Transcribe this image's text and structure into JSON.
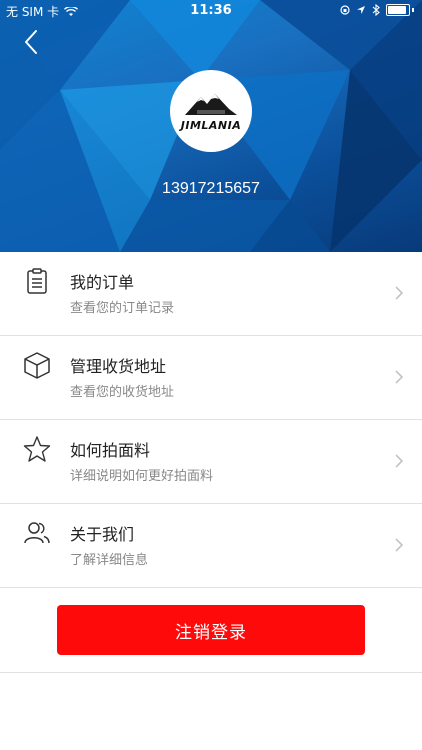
{
  "status_bar": {
    "carrier": "无 SIM 卡",
    "time": "11:36"
  },
  "header": {
    "logo_text": "JIMLANIA",
    "phone": "13917215657",
    "background_color": "#0e6ec4"
  },
  "menu": [
    {
      "title": "我的订单",
      "subtitle": "查看您的订单记录",
      "icon": "clipboard-icon"
    },
    {
      "title": "管理收货地址",
      "subtitle": "查看您的收货地址",
      "icon": "box-icon"
    },
    {
      "title": "如何拍面料",
      "subtitle": "详细说明如何更好拍面料",
      "icon": "star-icon"
    },
    {
      "title": "关于我们",
      "subtitle": "了解详细信息",
      "icon": "users-icon"
    }
  ],
  "logout": {
    "label": "注销登录",
    "color": "#ff0a0a"
  }
}
